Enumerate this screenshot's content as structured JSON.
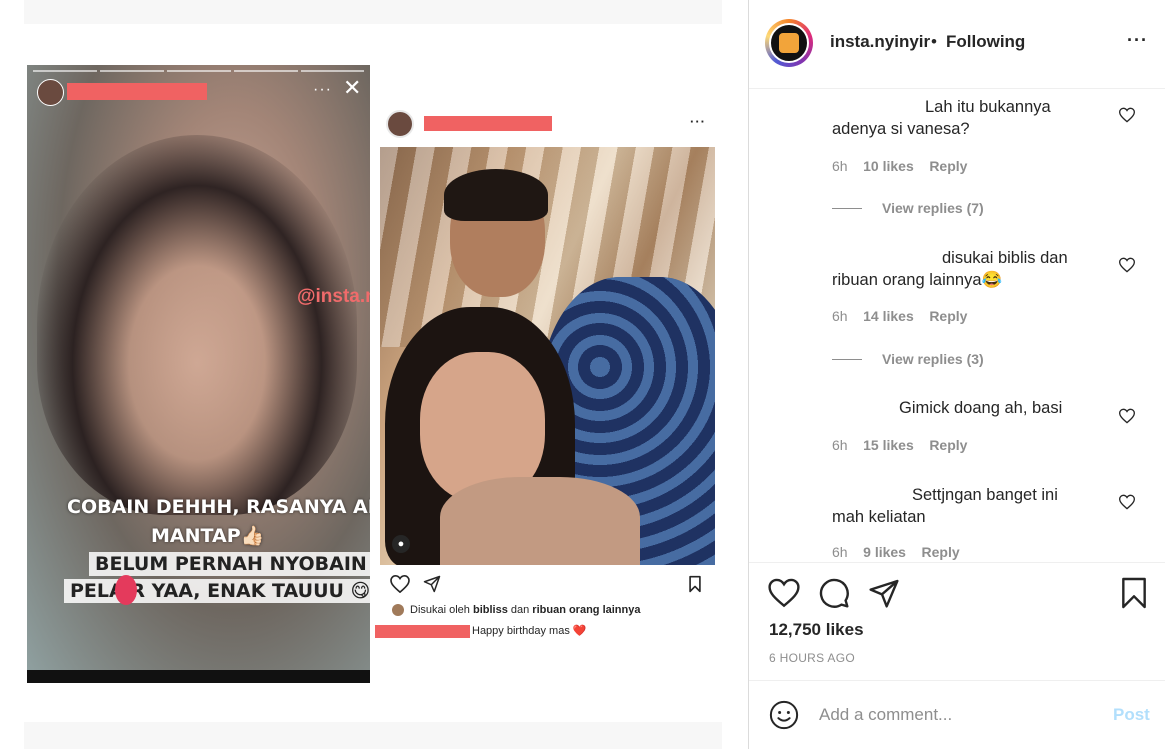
{
  "story": {
    "watermark": "@insta.nyinyir",
    "captions": [
      "COBAIN DEHHH, RASANYA AHH",
      "MANTAP👍🏻",
      "BELUM PERNAH NYOBAIN",
      "PELA R YAA, ENAK TAUUU 😋"
    ],
    "menu_icon": "more-icon",
    "close_icon": "close-icon"
  },
  "feed_post": {
    "likes_text_prefix": "Disukai oleh ",
    "likes_user": "bibliss",
    "likes_mid": " dan ",
    "likes_others": "ribuan orang lainnya",
    "caption": "Happy birthday mas ",
    "caption_emoji": "❤️",
    "more": "···"
  },
  "header": {
    "username": "insta.nyinyir",
    "separator": "•",
    "follow_status": "Following",
    "more": "···"
  },
  "comments": [
    {
      "text": "Lah itu bukannya adenya si vanesa?",
      "time": "6h",
      "likes": "10 likes",
      "reply": "Reply",
      "view_replies": "View replies (7)"
    },
    {
      "text": "disukai biblis dan ribuan orang lainnya😂",
      "time": "6h",
      "likes": "14 likes",
      "reply": "Reply",
      "view_replies": "View replies (3)"
    },
    {
      "text": "Gimick doang ah, basi",
      "time": "6h",
      "likes": "15 likes",
      "reply": "Reply"
    },
    {
      "text": "Settjngan banget ini mah keliatan",
      "time": "6h",
      "likes": "9 likes",
      "reply": "Reply"
    }
  ],
  "actions": {
    "like_icon": "heart-icon",
    "comment_icon": "comment-icon",
    "share_icon": "share-icon",
    "save_icon": "bookmark-icon"
  },
  "post_stats": {
    "likes": "12,750 likes",
    "time": "6 HOURS AGO"
  },
  "comment_box": {
    "placeholder": "Add a comment...",
    "post_label": "Post",
    "emoji_icon": "smile-icon"
  },
  "colors": {
    "redaction": "#f06262",
    "post_disabled": "#b2dffc",
    "muted": "#8e8e8e"
  }
}
